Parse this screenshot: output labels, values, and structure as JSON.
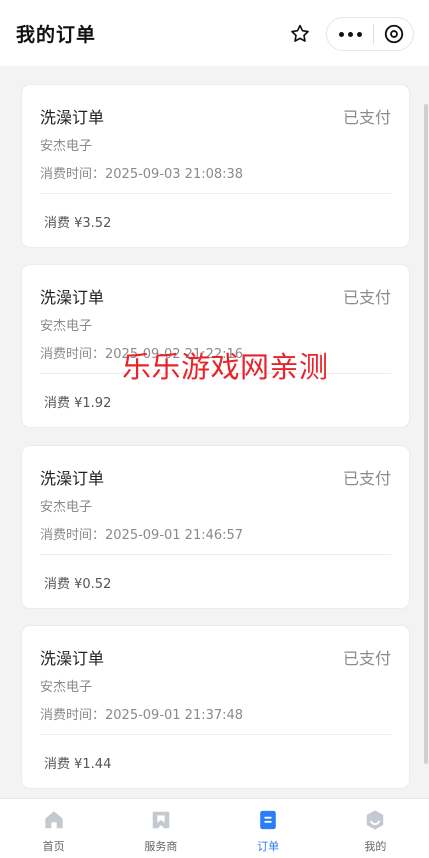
{
  "header": {
    "title": "我的订单"
  },
  "orders": [
    {
      "title": "洗澡订单",
      "status": "已支付",
      "shop": "安杰电子",
      "time": "消费时间：2025-09-03 21:08:38",
      "amount": "消费 ¥3.52"
    },
    {
      "title": "洗澡订单",
      "status": "已支付",
      "shop": "安杰电子",
      "time": "消费时间：2025-09-02 21:22:16",
      "amount": "消费 ¥1.92"
    },
    {
      "title": "洗澡订单",
      "status": "已支付",
      "shop": "安杰电子",
      "time": "消费时间：2025-09-01 21:46:57",
      "amount": "消费 ¥0.52"
    },
    {
      "title": "洗澡订单",
      "status": "已支付",
      "shop": "安杰电子",
      "time": "消费时间：2025-09-01 21:37:48",
      "amount": "消费 ¥1.44"
    }
  ],
  "watermark": "乐乐游戏网亲测",
  "tabbar": {
    "items": [
      {
        "label": "首页",
        "icon": "home-icon"
      },
      {
        "label": "服务商",
        "icon": "bookmark-icon"
      },
      {
        "label": "订单",
        "icon": "order-icon"
      },
      {
        "label": "我的",
        "icon": "profile-icon"
      }
    ],
    "active_index": 2,
    "active_color": "#2b7ef5",
    "inactive_color": "#c4c8cf"
  }
}
